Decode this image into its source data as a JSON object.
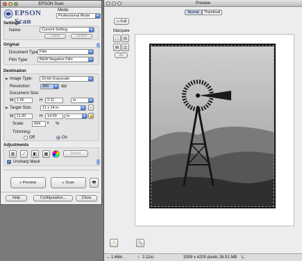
{
  "scan_window": {
    "title": "EPSON Scan",
    "logo_text": "EPSON Scan",
    "mode_label": "Mode:",
    "mode_value": "Professional Mode",
    "settings": {
      "heading": "Settings",
      "name_label": "Name:",
      "name_value": "Current Setting",
      "save_label": "Save",
      "delete_label": "Delete"
    },
    "original": {
      "heading": "Original",
      "document_type_label": "Document Type:",
      "document_type_value": "Film",
      "film_type_label": "Film Type:",
      "film_type_value": "B&W Negative Film"
    },
    "destination": {
      "heading": "Destination",
      "image_type_label": "Image Type:",
      "image_type_value": "16-bit Grayscale",
      "resolution_label": "Resolution:",
      "resolution_value": "300",
      "resolution_unit": "dpi",
      "document_size_label": "Document Size:",
      "doc_w_label": "W",
      "doc_w_value": "1.66",
      "doc_h_label": "H",
      "doc_h_value": "2.11",
      "doc_unit": "in.",
      "target_size_label": "Target Size:",
      "target_size_value": "11 x 14 in.",
      "tgt_w_label": "W",
      "tgt_w_value": "11.00",
      "tgt_h_label": "H",
      "tgt_h_value": "14.00",
      "tgt_unit": "in.",
      "scale_label": "Scale:",
      "scale_value": "664",
      "scale_unit": "%",
      "trimming_label": "Trimming:",
      "trimming_off": "Off",
      "trimming_on": "On"
    },
    "adjustments": {
      "heading": "Adjustments",
      "reset_label": "Reset",
      "unsharp_mask_label": "Unsharp Mask"
    },
    "preview_label": "Preview",
    "scan_label": "Scan",
    "help_label": "Help",
    "configuration_label": "Configuration...",
    "close_label": "Close"
  },
  "preview_window": {
    "title": "Preview",
    "tab_normal": "Normal",
    "tab_thumbnail": "Thumbnail",
    "full_label": "Full",
    "marquee_label": "Marquee",
    "all_label": "All",
    "status_width": "1.66in.",
    "status_height": "2.11in.",
    "status_pixels": "3309 x 4200 pixels 26.51 MB",
    "status_extra": "L:"
  },
  "colors": {
    "accent": "#3e6fd0",
    "logo_blue": "#3b4c86",
    "window_bg": "#ececec",
    "desktop": "#7a7a7a"
  },
  "icons": [
    "close-icon",
    "minimize-icon",
    "zoom-icon",
    "disclosure-triangle-icon",
    "lock-icon",
    "histogram-icon",
    "tone-curve-icon",
    "color-balance-icon",
    "color-palette-icon",
    "scan-icon",
    "marquee-new-icon",
    "marquee-delete-icon",
    "auto-locate-icon",
    "fit-window-icon",
    "zoom-preview-icon",
    "help-icon"
  ]
}
